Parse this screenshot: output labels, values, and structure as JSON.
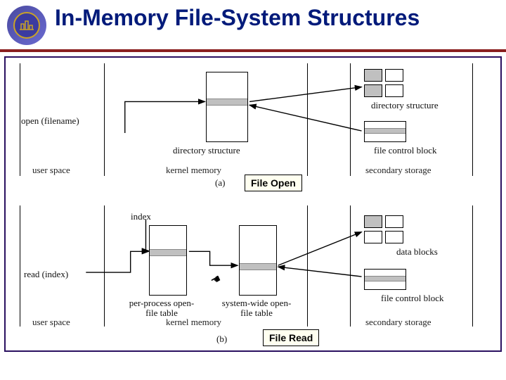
{
  "header": {
    "title": "In-Memory File-System Structures"
  },
  "zones": {
    "user_space": "user space",
    "kernel_memory": "kernel memory",
    "secondary_storage": "secondary storage"
  },
  "panel_a": {
    "id": "(a)",
    "call": "open (filename)",
    "dir_struct_label": "directory structure",
    "remote_dir_label": "directory structure",
    "fcb_label": "file control block",
    "callout": "File Open"
  },
  "panel_b": {
    "id": "(b)",
    "call": "read (index)",
    "index_label": "index",
    "perproc_label": "per-process open-file table",
    "syswide_label": "system-wide open-file table",
    "data_blocks_label": "data blocks",
    "fcb_label": "file control block",
    "callout": "File Read"
  }
}
